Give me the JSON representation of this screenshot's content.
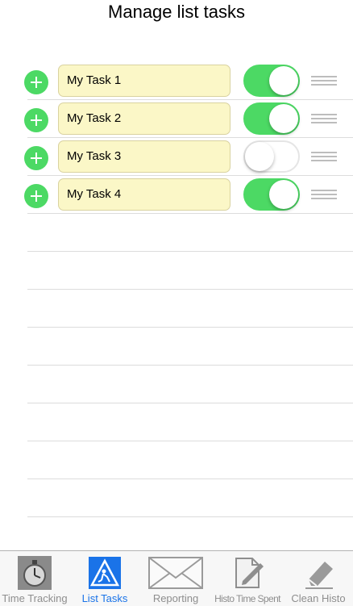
{
  "header": {
    "title": "Manage list tasks"
  },
  "tasks": [
    {
      "label": "My Task 1",
      "enabled": true
    },
    {
      "label": "My Task 2",
      "enabled": true
    },
    {
      "label": "My Task 3",
      "enabled": false
    },
    {
      "label": "My Task 4",
      "enabled": true
    }
  ],
  "tabbar": {
    "tabs": [
      {
        "label": "Time Tracking",
        "icon": "stopwatch-icon",
        "active": false
      },
      {
        "label": "List Tasks",
        "icon": "road-sign-icon",
        "active": true
      },
      {
        "label": "Reporting",
        "icon": "envelope-icon",
        "active": false
      },
      {
        "label": "Histo Time Spent",
        "icon": "document-edit-icon",
        "active": false
      },
      {
        "label": "Clean Histo",
        "icon": "eraser-icon",
        "active": false
      }
    ]
  },
  "colors": {
    "accent_green": "#4cd964",
    "field_bg": "#fbf7c7",
    "active_tab": "#1a73e8"
  }
}
